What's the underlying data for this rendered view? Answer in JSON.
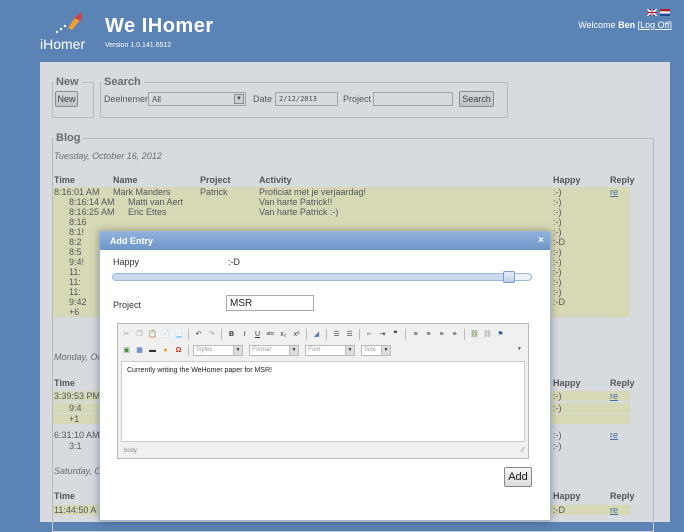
{
  "header": {
    "logo_text": "iHomer",
    "title": "We IHomer",
    "version": "Version 1.0.141.6512",
    "welcome": "Welcome",
    "user": "Ben",
    "logoff_open": "[",
    "logoff": "Log Off",
    "logoff_close": "]"
  },
  "new_section": {
    "legend": "New",
    "button": "New"
  },
  "search": {
    "legend": "Search",
    "deelnemer_label": "Deelnemer",
    "deelnemer_value": "All",
    "date_label": "Date",
    "date_value": "2/12/2013",
    "project_label": "Project",
    "project_value": "",
    "button": "Search"
  },
  "blog": {
    "legend": "Blog",
    "columns": {
      "time": "Time",
      "name": "Name",
      "project": "Project",
      "activity": "Activity",
      "happy": "Happy",
      "reply": "Reply"
    },
    "date1": "Tuesday, October 16, 2012",
    "date2": "Monday, Oc",
    "date3": "Saturday, C",
    "group1": [
      {
        "time": "8:16:01 AM",
        "name": "Mark Manders",
        "project": "Patrick",
        "activity": "Proficiat met je verjaardag!",
        "happy": ":-)",
        "reply": "re"
      },
      {
        "time": "8:16:14 AM",
        "name": "Matti van Aert",
        "project": "",
        "activity": "Van harte Patrick!!",
        "happy": ":-)",
        "reply": ""
      },
      {
        "time": "8:16:25 AM",
        "name": "Eric Ettes",
        "project": "",
        "activity": "Van harte Patrick :-)",
        "happy": ":-)",
        "reply": ""
      },
      {
        "time": "8:16",
        "name": "",
        "project": "",
        "activity": "",
        "happy": ":-)",
        "reply": ""
      },
      {
        "time": "8:1!",
        "name": "",
        "project": "",
        "activity": "",
        "happy": ":-)",
        "reply": ""
      },
      {
        "time": "8:2",
        "name": "",
        "project": "",
        "activity": "",
        "happy": ":-D",
        "reply": ""
      },
      {
        "time": "8:5",
        "name": "",
        "project": "",
        "activity": "",
        "happy": ":-)",
        "reply": ""
      },
      {
        "time": "9:4!",
        "name": "",
        "project": "",
        "activity": "",
        "happy": ":-)",
        "reply": ""
      },
      {
        "time": "11:",
        "name": "",
        "project": "",
        "activity": "",
        "happy": ":-)",
        "reply": ""
      },
      {
        "time": "11:",
        "name": "",
        "project": "",
        "activity": "",
        "happy": ":-)",
        "reply": ""
      },
      {
        "time": "11:",
        "name": "",
        "project": "",
        "activity": "",
        "happy": ":-)",
        "reply": ""
      },
      {
        "time": "9:42",
        "name": "",
        "project": "",
        "activity": "",
        "happy": ":-D",
        "reply": ""
      },
      {
        "time": "+6",
        "name": "",
        "project": "",
        "activity": "",
        "happy": "",
        "reply": ""
      }
    ],
    "group2": [
      {
        "time": "3:39:53 PM",
        "happy": ":-)",
        "reply": "re"
      },
      {
        "time": "9:4",
        "happy": ":-)",
        "reply": ""
      },
      {
        "time": "+1",
        "happy": "",
        "reply": ""
      },
      {
        "time": "6:31:10 AM",
        "happy": ":-)",
        "reply": "re"
      },
      {
        "time": "3:1",
        "happy": ":-)",
        "reply": ""
      }
    ],
    "group3": [
      {
        "time": "11:44:50 A",
        "happy": ":-D",
        "reply": "re"
      }
    ]
  },
  "dialog": {
    "title": "Add Entry",
    "close": "×",
    "happy_label": "Happy",
    "happy_value": ":-D",
    "happy_level_percent": 96,
    "project_label": "Project",
    "project_value": "MSR",
    "toolbar": {
      "styles": "Styles",
      "format": "Format",
      "font": "Font",
      "size": "Size"
    },
    "editor_text": "Currently writing the WeHomer paper for MSR!",
    "editor_path": "body",
    "add_button": "Add"
  },
  "colors": {
    "header_bg": "#5b83b6",
    "row_highlight": "#fffec2",
    "dialog_title": "#7aa0d0",
    "link": "#2255aa"
  }
}
